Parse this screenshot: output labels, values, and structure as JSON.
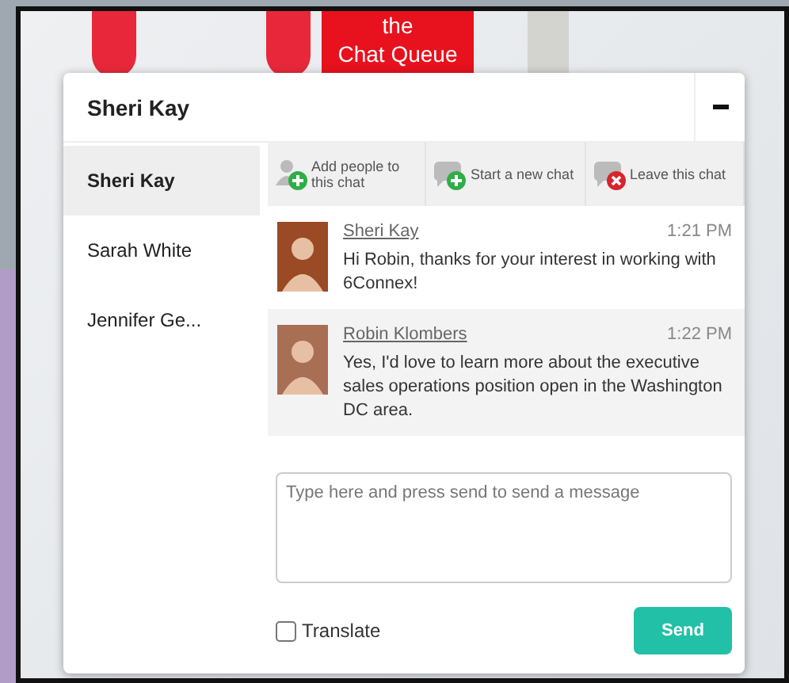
{
  "backdrop": {
    "sign_lines": [
      "the",
      "Chat Queue"
    ]
  },
  "chat_window": {
    "title": "Sheri Kay",
    "contacts": [
      {
        "name": "Sheri Kay",
        "selected": true
      },
      {
        "name": "Sarah White",
        "selected": false
      },
      {
        "name": "Jennifer Ge...",
        "selected": false
      }
    ],
    "actions": [
      {
        "kind": "add",
        "label": "Add people to this chat"
      },
      {
        "kind": "new",
        "label": "Start a new chat"
      },
      {
        "kind": "leave",
        "label": "Leave this chat"
      }
    ],
    "messages": [
      {
        "sender": "Sheri Kay",
        "time": "1:21 PM",
        "text": "Hi Robin, thanks for your interest in working with 6Connex!"
      },
      {
        "sender": "Robin Klombers",
        "time": "1:22 PM",
        "text": "Yes, I'd love to learn more about the executive sales operations position open in the Washington DC area."
      }
    ],
    "composer": {
      "placeholder": "Type here and press send to send a message",
      "translate_label": "Translate",
      "translate_checked": false,
      "send_label": "Send"
    }
  }
}
